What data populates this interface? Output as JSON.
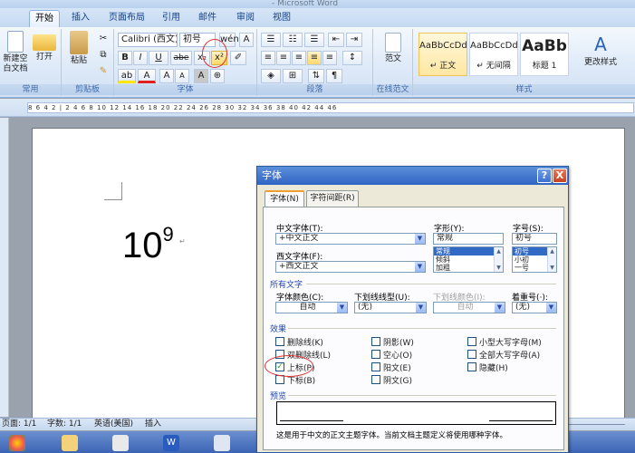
{
  "titlebar": {
    "text": "- Microsoft Word"
  },
  "tabs": [
    {
      "label": "开始",
      "active": true
    },
    {
      "label": "插入"
    },
    {
      "label": "页面布局"
    },
    {
      "label": "引用"
    },
    {
      "label": "邮件"
    },
    {
      "label": "审阅"
    },
    {
      "label": "视图"
    }
  ],
  "ribbon": {
    "groups": {
      "common": "常用",
      "clipboard": "剪贴板",
      "font": "字体",
      "paragraph": "段落",
      "online_template": "在线范文",
      "styles": "样式"
    },
    "new_blank": "新建空\n白文档",
    "open": "打开",
    "paste": "粘贴",
    "font_name": "Calibri (西文)",
    "font_size": "初号",
    "template_label": "范文",
    "change_styles": "更改样式",
    "styles": [
      {
        "preview": "AaBbCcDd",
        "name": "↵ 正文",
        "selected": true
      },
      {
        "preview": "AaBbCcDd",
        "name": "↵ 无间隔"
      },
      {
        "preview": "AaBb",
        "name": "标题 1"
      }
    ],
    "icons": {
      "bold": "B",
      "italic": "I",
      "underline": "U",
      "strike": "abe",
      "subscript": "x₂",
      "superscript": "x²",
      "font_color": "A",
      "highlight": "ab"
    }
  },
  "ruler": {
    "marks": "8 6 4 2 | 2 4 6 8 10 12 14 16 18 20 22 24 26 28 30 32 34 36 38 40 42 44 46"
  },
  "document": {
    "base": "10",
    "exponent": "9",
    "para_mark": "↵"
  },
  "status": {
    "page": "页面: 1/1",
    "words": "字数: 1/1",
    "language": "英语(美国)",
    "mode": "插入"
  },
  "dialog": {
    "title": "字体",
    "help": "?",
    "close": "X",
    "tabs": [
      "字体(N)",
      "字符间距(R)"
    ],
    "cn_font_label": "中文字体(T):",
    "cn_font_value": "+中文正文",
    "style_label": "字形(Y):",
    "style_value": "常规",
    "style_options": [
      "常规",
      "倾斜",
      "加粗"
    ],
    "size_label": "字号(S):",
    "size_value": "初号",
    "size_options": [
      "初号",
      "小初",
      "一号"
    ],
    "west_font_label": "西文字体(F):",
    "west_font_value": "+西文正文",
    "all_text_section": "所有文字",
    "font_color_label": "字体颜色(C):",
    "font_color_value": "自动",
    "underline_label": "下划线线型(U):",
    "underline_value": "(无)",
    "underline_color_label": "下划线颜色(I):",
    "underline_color_value": "自动",
    "emphasis_label": "着重号(·):",
    "emphasis_value": "(无)",
    "effects_section": "效果",
    "effects": [
      {
        "label": "删除线(K)",
        "checked": false
      },
      {
        "label": "阴影(W)",
        "checked": false
      },
      {
        "label": "小型大写字母(M)",
        "checked": false
      },
      {
        "label": "双删除线(L)",
        "checked": false
      },
      {
        "label": "空心(O)",
        "checked": false
      },
      {
        "label": "全部大写字母(A)",
        "checked": false
      },
      {
        "label": "上标(P)",
        "checked": true
      },
      {
        "label": "阳文(E)",
        "checked": false
      },
      {
        "label": "隐藏(H)",
        "checked": false
      },
      {
        "label": "下标(B)",
        "checked": false
      },
      {
        "label": "阴文(G)",
        "checked": false
      }
    ],
    "preview_section": "预览",
    "preview_note": "这是用于中文的正文主题字体。当前文档主题定义将使用哪种字体。"
  }
}
